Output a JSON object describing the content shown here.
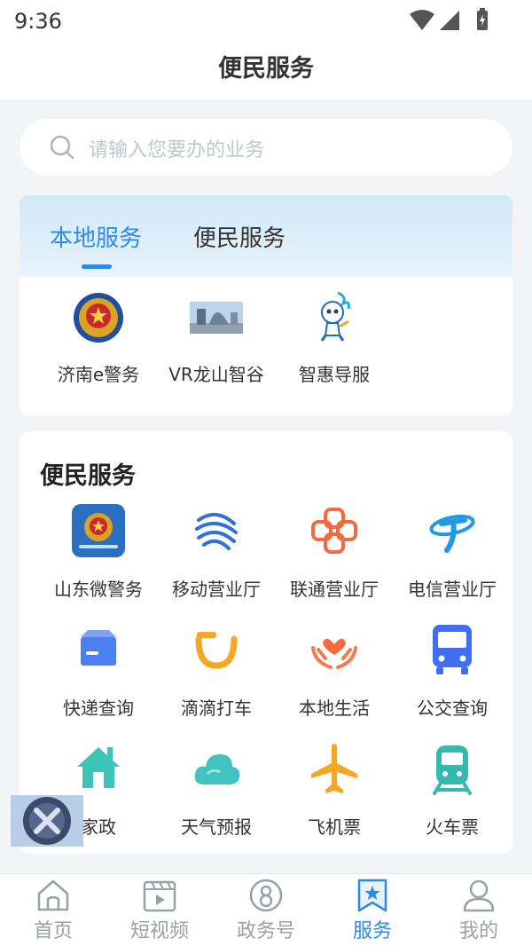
{
  "status_bar": {
    "time": "9:36"
  },
  "header": {
    "title": "便民服务"
  },
  "search": {
    "placeholder": "请输入您要办的业务"
  },
  "local_card": {
    "tabs": [
      {
        "label": "本地服务",
        "active": true
      },
      {
        "label": "便民服务",
        "active": false
      }
    ],
    "items": [
      {
        "label": "济南e警务",
        "icon": "police-badge-icon"
      },
      {
        "label": "VR龙山智谷",
        "icon": "building-photo-icon"
      },
      {
        "label": "智惠导服",
        "icon": "mascot-icon"
      }
    ]
  },
  "services": {
    "title": "便民服务",
    "items": [
      {
        "label": "山东微警务",
        "icon": "police-app-icon"
      },
      {
        "label": "移动营业厅",
        "icon": "china-mobile-icon"
      },
      {
        "label": "联通营业厅",
        "icon": "china-unicom-icon"
      },
      {
        "label": "电信营业厅",
        "icon": "china-telecom-icon"
      },
      {
        "label": "快递查询",
        "icon": "parcel-icon"
      },
      {
        "label": "滴滴打车",
        "icon": "didi-icon"
      },
      {
        "label": "本地生活",
        "icon": "heart-hands-icon"
      },
      {
        "label": "公交查询",
        "icon": "bus-icon"
      },
      {
        "label": "家政",
        "icon": "house-icon"
      },
      {
        "label": "天气预报",
        "icon": "cloud-icon"
      },
      {
        "label": "飞机票",
        "icon": "airplane-icon"
      },
      {
        "label": "火车票",
        "icon": "train-icon"
      }
    ]
  },
  "bottom_nav": [
    {
      "label": "首页",
      "icon": "home-icon",
      "active": false
    },
    {
      "label": "短视频",
      "icon": "video-icon",
      "active": false
    },
    {
      "label": "政务号",
      "icon": "gov-account-icon",
      "active": false
    },
    {
      "label": "服务",
      "icon": "service-bookmark-icon",
      "active": true
    },
    {
      "label": "我的",
      "icon": "profile-icon",
      "active": false
    }
  ],
  "colors": {
    "accent": "#2e8ae6",
    "police_blue": "#1f4fa0",
    "mobile_blue": "#2f6fd6",
    "unicom_orange": "#f26a3d",
    "telecom_blue": "#1f9be6",
    "express_blue": "#4d7ff0",
    "didi_orange": "#f5a623",
    "life_orange": "#f27a4d",
    "bus_blue": "#3f6ff0",
    "house_teal": "#3cc4b8",
    "weather_teal": "#42c2c0",
    "plane_orange": "#f5a623",
    "train_teal": "#35b8b0"
  }
}
